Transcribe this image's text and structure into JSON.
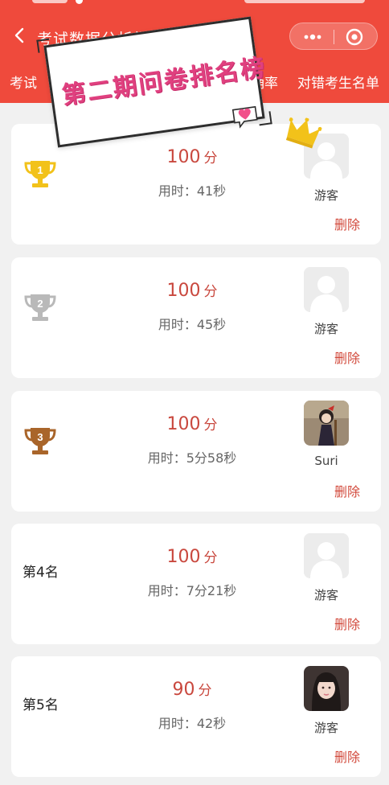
{
  "navbar": {
    "title": "考试数据分析报表"
  },
  "tabs": [
    {
      "label": "考试"
    },
    {
      "label": "确率"
    },
    {
      "label": "对错考生名单"
    }
  ],
  "banner": {
    "title": "第二期问卷排名榜"
  },
  "score_unit": "分",
  "delete_label": "删除",
  "rankings": [
    {
      "rank_label": "",
      "trophy": "gold-trophy-1",
      "score": "100",
      "time": "用时：41秒",
      "name": "游客",
      "avatar": "default-avatar"
    },
    {
      "rank_label": "",
      "trophy": "silver-trophy-2",
      "score": "100",
      "time": "用时：45秒",
      "name": "游客",
      "avatar": "default-avatar"
    },
    {
      "rank_label": "",
      "trophy": "bronze-trophy-3",
      "score": "100",
      "time": "用时：5分58秒",
      "name": "Suri",
      "avatar": "illustrated-girl-avatar"
    },
    {
      "rank_label": "第4名",
      "trophy": "",
      "score": "100",
      "time": "用时：7分21秒",
      "name": "游客",
      "avatar": "default-avatar"
    },
    {
      "rank_label": "第5名",
      "trophy": "",
      "score": "90",
      "time": "用时：42秒",
      "name": "游客",
      "avatar": "photo-girl-avatar"
    }
  ],
  "colors": {
    "brand_red": "#ef4a3c",
    "score_red": "#c9483e",
    "banner_pink": "#e0407f",
    "gold": "#f2c21a",
    "silver": "#b9b9b9",
    "bronze": "#a9652a"
  }
}
